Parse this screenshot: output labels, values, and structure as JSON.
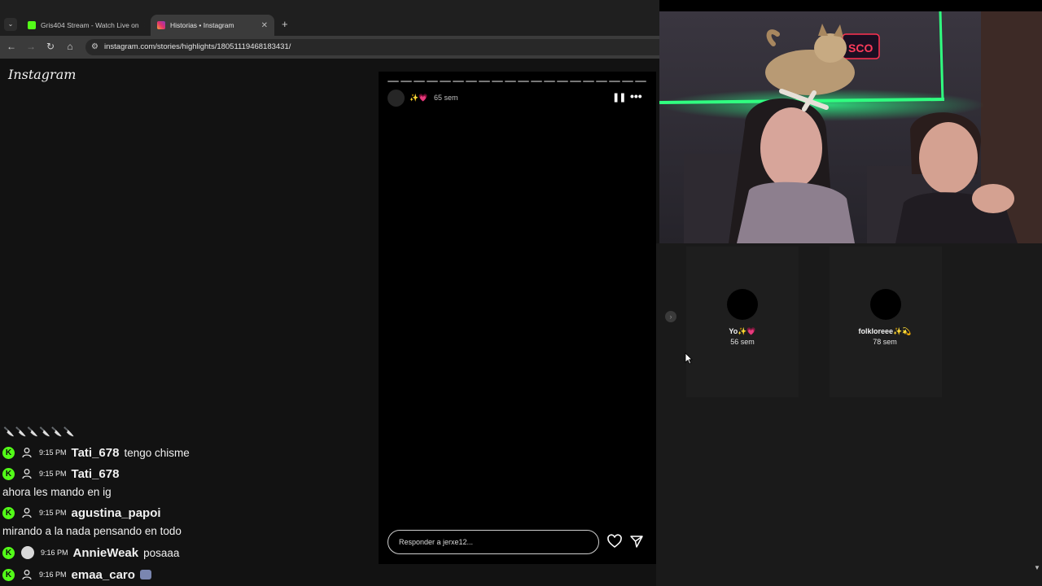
{
  "browser": {
    "tabs": [
      {
        "title": "Gris404 Stream - Watch Live on",
        "favicon_color": "#53fc18"
      },
      {
        "title": "Historias • Instagram",
        "favicon_color": "#e1306c"
      }
    ],
    "url": "instagram.com/stories/highlights/18051119468183431/"
  },
  "instagram": {
    "logo": "Instagram",
    "story": {
      "title_emojis": "✨💗",
      "time": "65 sem",
      "reply_placeholder": "Responder a jerxe12..."
    },
    "highlights": [
      {
        "name": "Yo✨💗",
        "time": "56 sem"
      },
      {
        "name": "folkloreee✨💫",
        "time": "78 sem"
      }
    ]
  },
  "chat": {
    "emoji_row": "🔪🔪🔪🔪🔪🔪",
    "messages": [
      {
        "time": "9:15 PM",
        "user": "Tati_678",
        "text": "tengo chisme"
      },
      {
        "time": "9:15 PM",
        "user": "Tati_678",
        "text": "ahora les mando en ig"
      },
      {
        "time": "9:15 PM",
        "user": "agustina_papoi",
        "text": "mirando a la nada pensando en todo"
      },
      {
        "time": "9:16 PM",
        "user": "AnnieWeak",
        "text": "posaaa"
      },
      {
        "time": "9:16 PM",
        "user": "emaa_caro",
        "text": ""
      }
    ]
  },
  "colors": {
    "kick_green": "#53fc18",
    "instagram_pink": "#e1306c",
    "neon_green": "#22ff77"
  }
}
